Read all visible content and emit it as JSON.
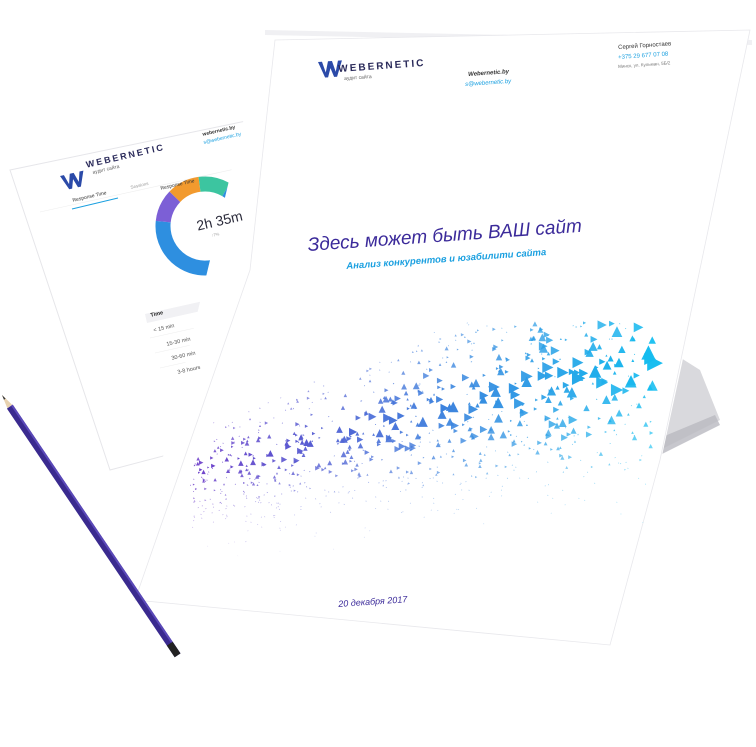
{
  "colors": {
    "brand_purple": "#3b2a9a",
    "brand_blue": "#1ba0e0",
    "pencil": "#3a2a8f"
  },
  "back_page": {
    "logo_text": "WEBERNETIC",
    "logo_sub": "аудит сайта",
    "site": "webernetic.by",
    "email": "s@webernetic.by",
    "tabs": [
      "Response Time",
      "Sessions"
    ],
    "donut_title": "Response Time",
    "donut_value": "2h 35m",
    "donut_sub": "↑7%",
    "table_header": "Time",
    "table_rows": [
      "< 15 min",
      "15-30 min",
      "30-60 min",
      "3-8 hours"
    ]
  },
  "front_page": {
    "logo_text": "WEBERNETIC",
    "logo_sub": "аудит сайта",
    "site": "Webernetic.by",
    "email": "s@webernetic.by",
    "contact_name": "Сергей Горностаев",
    "contact_phone": "+375 29 677 07 08",
    "contact_address": "Минск, ул. Кульман, 5Б/2",
    "headline": "Здесь может быть ВАШ сайт",
    "subline": "Анализ конкурентов и юзабилити сайта",
    "date": "20 декабря 2017"
  },
  "icons": [
    "webernetic-logo-icon",
    "pencil-icon"
  ]
}
